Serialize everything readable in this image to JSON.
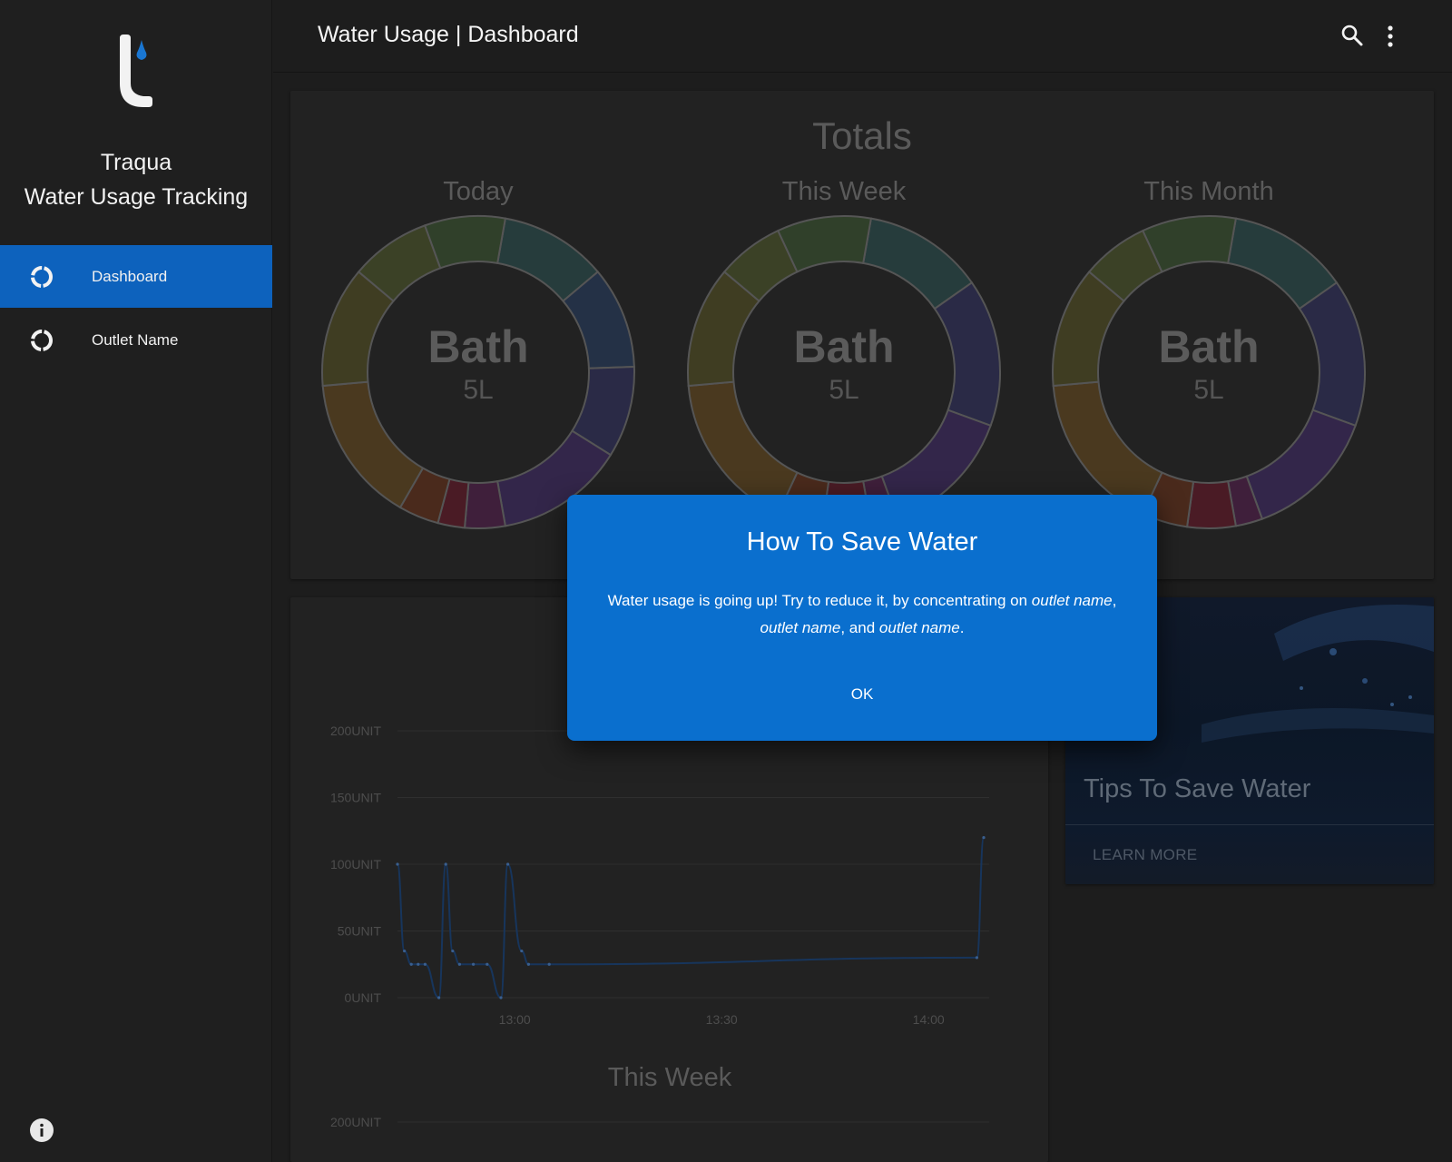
{
  "sidebar": {
    "brand_line1": "Traqua",
    "brand_line2": "Water Usage Tracking",
    "items": [
      {
        "label": "Dashboard",
        "active": true
      },
      {
        "label": "Outlet Name",
        "active": false
      }
    ]
  },
  "header": {
    "title": "Water Usage | Dashboard"
  },
  "totals": {
    "title": "Totals",
    "donuts": [
      {
        "title": "Today",
        "center_label": "Bath",
        "center_value": "5L"
      },
      {
        "title": "This Week",
        "center_label": "Bath",
        "center_value": "5L"
      },
      {
        "title": "This Month",
        "center_label": "Bath",
        "center_value": "5L"
      }
    ]
  },
  "chart_data": [
    {
      "type": "line",
      "title": "",
      "ylabel": "",
      "xlabel": "",
      "y_ticks": [
        "0UNIT",
        "50UNIT",
        "100UNIT",
        "150UNIT",
        "200UNIT"
      ],
      "x_ticks": [
        "13:00",
        "13:30",
        "14:00"
      ],
      "ylim": [
        0,
        200
      ],
      "grid": true,
      "series": [
        {
          "points": [
            {
              "x": "12:43",
              "y": 100
            },
            {
              "x": "12:44",
              "y": 35
            },
            {
              "x": "12:45",
              "y": 25
            },
            {
              "x": "12:46",
              "y": 25
            },
            {
              "x": "12:47",
              "y": 25
            },
            {
              "x": "12:49",
              "y": 0
            },
            {
              "x": "12:50",
              "y": 100
            },
            {
              "x": "12:51",
              "y": 35
            },
            {
              "x": "12:52",
              "y": 25
            },
            {
              "x": "12:54",
              "y": 25
            },
            {
              "x": "12:56",
              "y": 25
            },
            {
              "x": "12:58",
              "y": 0
            },
            {
              "x": "12:59",
              "y": 100
            },
            {
              "x": "13:01",
              "y": 35
            },
            {
              "x": "13:02",
              "y": 25
            },
            {
              "x": "13:05",
              "y": 25
            },
            {
              "x": "14:07",
              "y": 30
            },
            {
              "x": "14:08",
              "y": 120
            }
          ]
        }
      ]
    },
    {
      "type": "line",
      "title": "This Week",
      "y_ticks": [
        "200UNIT"
      ],
      "ylim": [
        0,
        200
      ],
      "series": []
    }
  ],
  "tips": {
    "title": "Tips To Save Water",
    "link": "LEARN MORE"
  },
  "dialog": {
    "title": "How To Save Water",
    "body_prefix": "Water usage is going up! Try to reduce it, by concentrating on ",
    "outlet1": "outlet name",
    "sep1": ", ",
    "outlet2": "outlet name",
    "sep2": ", and ",
    "outlet3": "outlet name",
    "suffix": ".",
    "ok": "OK"
  },
  "colors": {
    "accent": "#0d62bd",
    "dialog": "#0a6fce",
    "line": "#17355c"
  },
  "icons": {
    "nav": "donut-icon",
    "search": "search-icon",
    "more": "more-vert-icon",
    "info": "info-icon"
  }
}
